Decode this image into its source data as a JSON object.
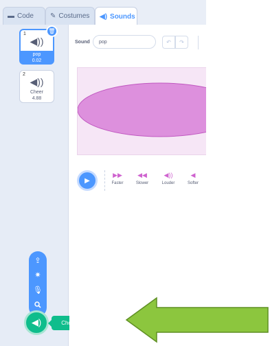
{
  "tabs": {
    "code": "Code",
    "costumes": "Costumes",
    "sounds": "Sounds"
  },
  "sounds": [
    {
      "number": "1",
      "name": "pop",
      "duration": "0.02"
    },
    {
      "number": "2",
      "name": "Cheer",
      "duration": "4.88"
    }
  ],
  "editor": {
    "sound_label": "Sound",
    "sound_name_value": "pop"
  },
  "effects": [
    {
      "label": "Faster",
      "icon": "faster-icon"
    },
    {
      "label": "Slower",
      "icon": "slower-icon"
    },
    {
      "label": "Louder",
      "icon": "louder-icon"
    },
    {
      "label": "Softer",
      "icon": "softer-icon"
    }
  ],
  "menu": {
    "tooltip": "Choose a Sound"
  },
  "colors": {
    "accent_blue": "#4c97ff",
    "sound_green": "#0fbd8c",
    "waveform_purple": "#cf63cf",
    "arrow_green": "#8cc63e"
  }
}
